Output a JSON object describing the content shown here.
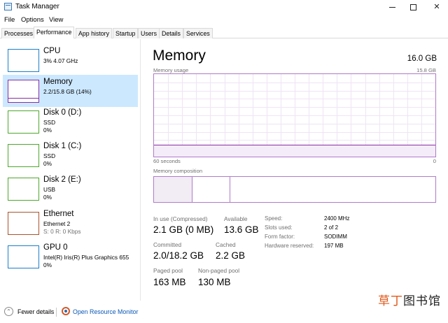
{
  "window": {
    "title": "Task Manager",
    "minimize": "—",
    "maximize": "☐",
    "close": "✕"
  },
  "menu": [
    "File",
    "Options",
    "View"
  ],
  "tabs": [
    "Processes",
    "Performance",
    "App history",
    "Startup",
    "Users",
    "Details",
    "Services"
  ],
  "active_tab": "Performance",
  "sidebar": [
    {
      "name": "CPU",
      "line1": "3% 4.07 GHz",
      "line2": "",
      "color": "#1c7fc8"
    },
    {
      "name": "Memory",
      "line1": "2.2/15.8 GB (14%)",
      "line2": "",
      "color": "#8b2da4",
      "selected": true
    },
    {
      "name": "Disk 0 (D:)",
      "line1": "SSD",
      "line2": "0%",
      "color": "#4ea72c"
    },
    {
      "name": "Disk 1 (C:)",
      "line1": "SSD",
      "line2": "0%",
      "color": "#4ea72c"
    },
    {
      "name": "Disk 2 (E:)",
      "line1": "USB",
      "line2": "0%",
      "color": "#4ea72c"
    },
    {
      "name": "Ethernet",
      "line1": "Ethernet 2",
      "line2": "S: 0 R: 0 Kbps",
      "color": "#a9542d"
    },
    {
      "name": "GPU 0",
      "line1": "Intel(R) Iris(R) Plus Graphics 655",
      "line2": "0%",
      "color": "#1c7fc8"
    }
  ],
  "main": {
    "title": "Memory",
    "total": "16.0 GB",
    "graph_label": "Memory usage",
    "graph_max": "15.8 GB",
    "time_label": "60 seconds",
    "time_end": "0",
    "composition_label": "Memory composition",
    "usage_fraction": 0.14,
    "stats": {
      "in_use_label": "In use (Compressed)",
      "in_use": "2.1 GB (0 MB)",
      "available_label": "Available",
      "available": "13.6 GB",
      "committed_label": "Committed",
      "committed": "2.0/18.2 GB",
      "cached_label": "Cached",
      "cached": "2.2 GB",
      "paged_label": "Paged pool",
      "paged": "163 MB",
      "nonpaged_label": "Non-paged pool",
      "nonpaged": "130 MB"
    },
    "specs": [
      {
        "label": "Speed:",
        "value": "2400 MHz"
      },
      {
        "label": "Slots used:",
        "value": "2 of 2"
      },
      {
        "label": "Form factor:",
        "value": "SODIMM"
      },
      {
        "label": "Hardware reserved:",
        "value": "197 MB"
      }
    ]
  },
  "footer": {
    "fewer_details": "Fewer details",
    "open_monitor": "Open Resource Monitor"
  },
  "watermark": {
    "part1": "草丁",
    "part2": "图书馆"
  },
  "colors": {
    "memory": "#8b2da4",
    "selected_bg": "#cce8ff",
    "link": "#0a58b6"
  }
}
